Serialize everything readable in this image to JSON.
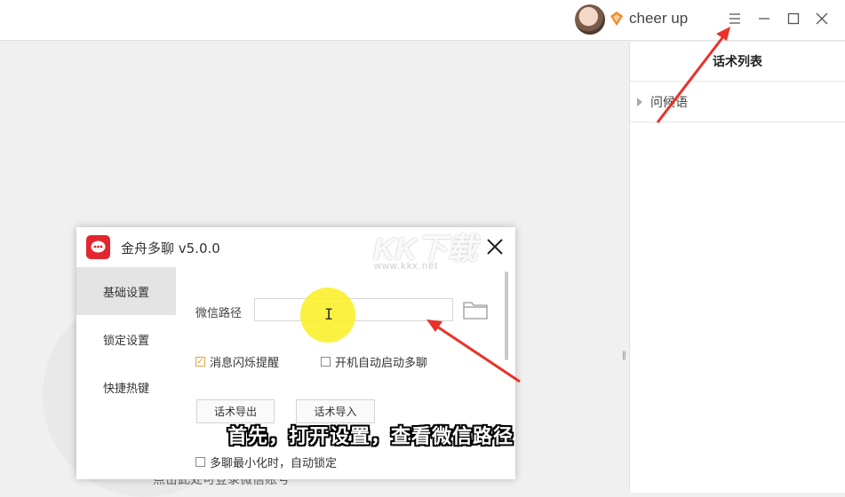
{
  "topbar": {
    "username": "cheer up",
    "icons": [
      "avatar",
      "vip-diamond-icon",
      "menu-icon",
      "minimize-icon",
      "maximize-icon",
      "close-icon"
    ]
  },
  "right_panel": {
    "title": "话术列表",
    "items": [
      {
        "label": "问候语"
      }
    ]
  },
  "background": {
    "hint_text": "点击此处可登录微信账号"
  },
  "dialog": {
    "title": "金舟多聊 v5.0.0",
    "sidebar": [
      {
        "label": "基础设置",
        "active": true
      },
      {
        "label": "锁定设置",
        "active": false
      },
      {
        "label": "快捷热键",
        "active": false
      }
    ],
    "path_label": "微信路径",
    "path_value": "",
    "options": {
      "flash_notify": {
        "label": "消息闪烁提醒",
        "checked": true
      },
      "autostart": {
        "label": "开机自动启动多聊",
        "checked": false
      },
      "lock_on_minimize": {
        "label": "多聊最小化时，自动锁定",
        "checked": false
      }
    },
    "buttons": {
      "export": "话术导出",
      "import": "话术导入"
    }
  },
  "overlay": {
    "subtitle": "首先，打开设置，查看微信路径",
    "watermark_logo": "KK下载",
    "watermark_url": "www.kkx.net"
  },
  "colors": {
    "accent_red": "#e3262e",
    "check_orange": "#e9a23b",
    "highlight_yellow": "#faee1e",
    "arrow_red": "#e8322a"
  }
}
